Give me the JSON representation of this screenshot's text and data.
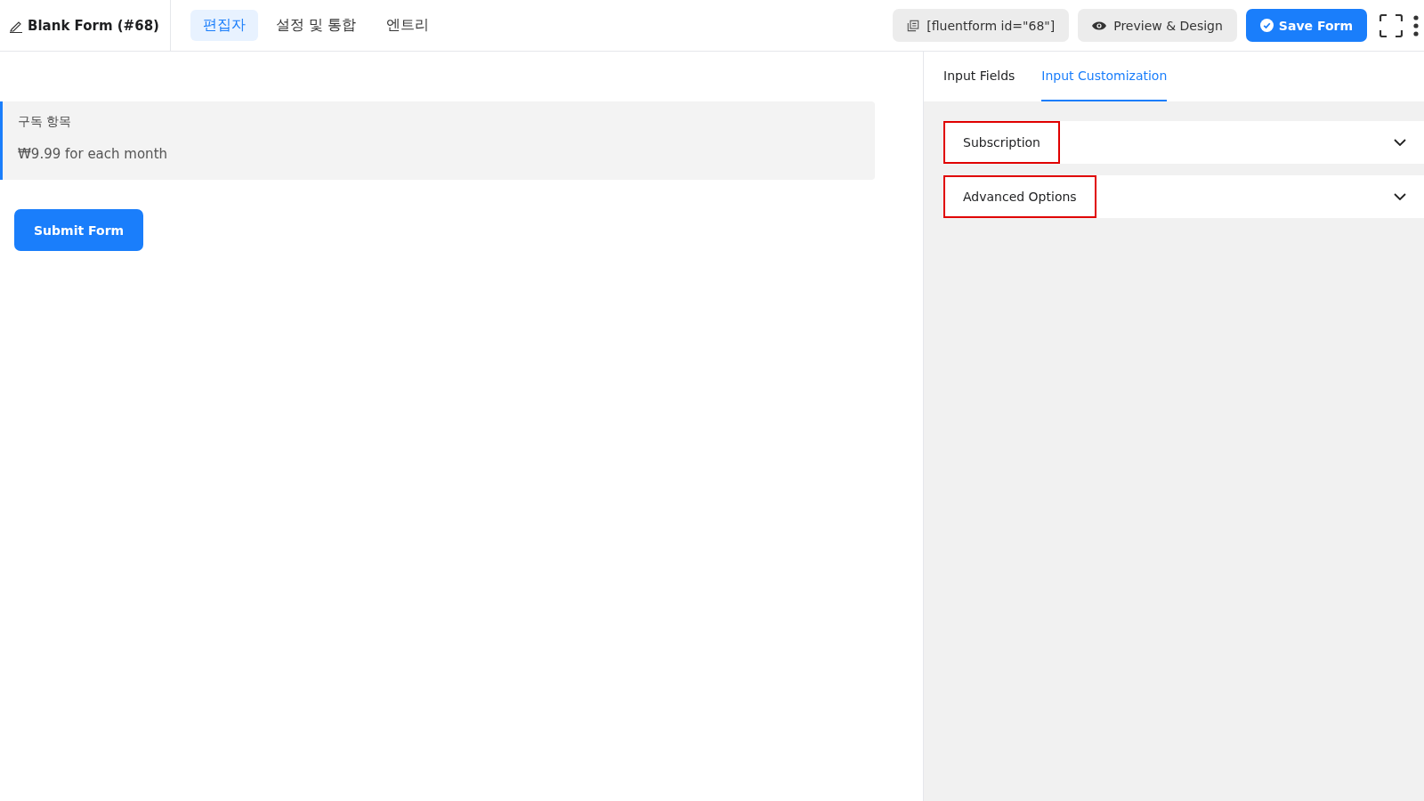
{
  "header": {
    "title": "Blank Form (#68)",
    "nav": [
      {
        "label": "편집자",
        "selected": true
      },
      {
        "label": "설정 및 통합",
        "selected": false
      },
      {
        "label": "엔트리",
        "selected": false
      }
    ],
    "shortcode": "[fluentform id=\"68\"]",
    "preview_button": "Preview & Design",
    "save_button": "Save Form"
  },
  "form": {
    "field": {
      "label": "구독 항목",
      "value": "₩9.99 for each month",
      "selected": true
    },
    "submit_button": "Submit Form"
  },
  "panel": {
    "tabs": [
      {
        "label": "Input Fields",
        "selected": false
      },
      {
        "label": "Input Customization",
        "selected": true
      }
    ],
    "sections": [
      {
        "title": "Subscription",
        "expanded": false,
        "highlighted": true
      },
      {
        "title": "Advanced Options",
        "expanded": false,
        "highlighted": true
      }
    ]
  }
}
